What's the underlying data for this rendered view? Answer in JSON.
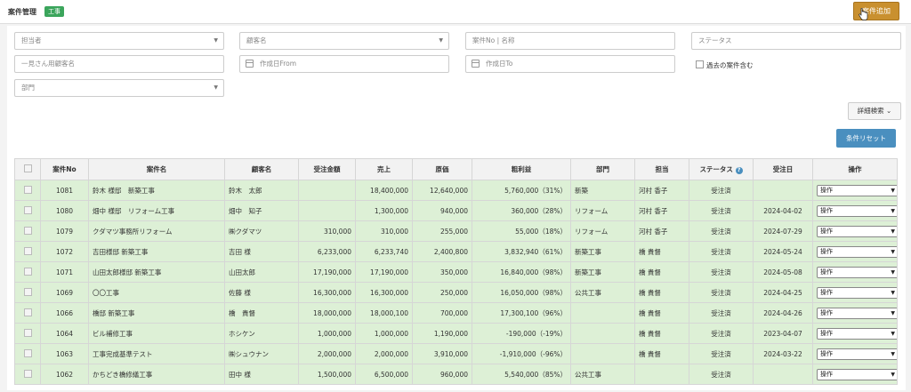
{
  "header": {
    "title": "案件管理",
    "badge": "工事",
    "add_button": "案件追加"
  },
  "filters": {
    "assignee": "担当者",
    "customer": "顧客名",
    "case_no_name": "案件No | 名称",
    "status": "ステータス",
    "list_customer": "一見さん用顧客名",
    "created_from": "作成日From",
    "created_to": "作成日To",
    "include_past": "過去の案件含む",
    "department": "部門",
    "caret": "▼"
  },
  "buttons": {
    "detail_search": "詳細検索",
    "detail_chevron": "⌄",
    "reset": "条件リセット"
  },
  "table": {
    "headers": [
      "",
      "案件No",
      "案件名",
      "顧客名",
      "受注金額",
      "売上",
      "原価",
      "粗利益",
      "部門",
      "担当",
      "ステータス",
      "受注日",
      "操作"
    ],
    "help_icon": "?",
    "rows": [
      {
        "no": "1081",
        "name": "鈴木 様邸　新築工事",
        "customer": "鈴木　太郎",
        "order": "",
        "sales": "18,400,000",
        "cost": "12,640,000",
        "profit": "5,760,000（31%）",
        "dept": "新築",
        "staff": "河村 香子",
        "status": "受注済",
        "date": "",
        "op": "操作"
      },
      {
        "no": "1080",
        "name": "畑中 様邸　リフォーム工事",
        "customer": "畑中　知子",
        "order": "",
        "sales": "1,300,000",
        "cost": "940,000",
        "profit": "360,000（28%）",
        "dept": "リフォーム",
        "staff": "河村 香子",
        "status": "受注済",
        "date": "2024-04-02",
        "op": "操作"
      },
      {
        "no": "1079",
        "name": "クダマツ事務所リフォーム",
        "customer": "㈱クダマツ",
        "order": "310,000",
        "sales": "310,000",
        "cost": "255,000",
        "profit": "55,000（18%）",
        "dept": "リフォーム",
        "staff": "河村 香子",
        "status": "受注済",
        "date": "2024-07-29",
        "op": "操作"
      },
      {
        "no": "1072",
        "name": "吉田様邸 新築工事",
        "customer": "吉田 様",
        "order": "6,233,000",
        "sales": "6,233,740",
        "cost": "2,400,800",
        "profit": "3,832,940（61%）",
        "dept": "新築工事",
        "staff": "橋 貴督",
        "status": "受注済",
        "date": "2024-05-24",
        "op": "操作"
      },
      {
        "no": "1071",
        "name": "山田太郎様邸 新築工事",
        "customer": "山田太郎",
        "order": "17,190,000",
        "sales": "17,190,000",
        "cost": "350,000",
        "profit": "16,840,000（98%）",
        "dept": "新築工事",
        "staff": "橋 貴督",
        "status": "受注済",
        "date": "2024-05-08",
        "op": "操作"
      },
      {
        "no": "1069",
        "name": "〇〇工事",
        "customer": "佐藤 様",
        "order": "16,300,000",
        "sales": "16,300,000",
        "cost": "250,000",
        "profit": "16,050,000（98%）",
        "dept": "公共工事",
        "staff": "橋 貴督",
        "status": "受注済",
        "date": "2024-04-25",
        "op": "操作"
      },
      {
        "no": "1066",
        "name": "橋邸 新築工事",
        "customer": "橋　貴督",
        "order": "18,000,000",
        "sales": "18,000,100",
        "cost": "700,000",
        "profit": "17,300,100（96%）",
        "dept": "",
        "staff": "橋 貴督",
        "status": "受注済",
        "date": "2024-04-26",
        "op": "操作"
      },
      {
        "no": "1064",
        "name": "ビル補修工事",
        "customer": "ホシケン",
        "order": "1,000,000",
        "sales": "1,000,000",
        "cost": "1,190,000",
        "profit": "-190,000（-19%）",
        "dept": "",
        "staff": "橋 貴督",
        "status": "受注済",
        "date": "2023-04-07",
        "op": "操作"
      },
      {
        "no": "1063",
        "name": "工事完成基準テスト",
        "customer": "㈱シュウナン",
        "order": "2,000,000",
        "sales": "2,000,000",
        "cost": "3,910,000",
        "profit": "-1,910,000（-96%）",
        "dept": "",
        "staff": "橋 貴督",
        "status": "受注済",
        "date": "2024-03-22",
        "op": "操作"
      },
      {
        "no": "1062",
        "name": "かちどき橋修繕工事",
        "customer": "田中 様",
        "order": "1,500,000",
        "sales": "6,500,000",
        "cost": "960,000",
        "profit": "5,540,000（85%）",
        "dept": "公共工事",
        "staff": "",
        "status": "受注済",
        "date": "",
        "op": "操作"
      }
    ]
  },
  "colors": {
    "accent_button": "#c9902f",
    "badge": "#3ba55c",
    "row_bg": "#ddf0d6",
    "link_blue": "#2a74b8",
    "negative_red": "#d13a2a"
  }
}
